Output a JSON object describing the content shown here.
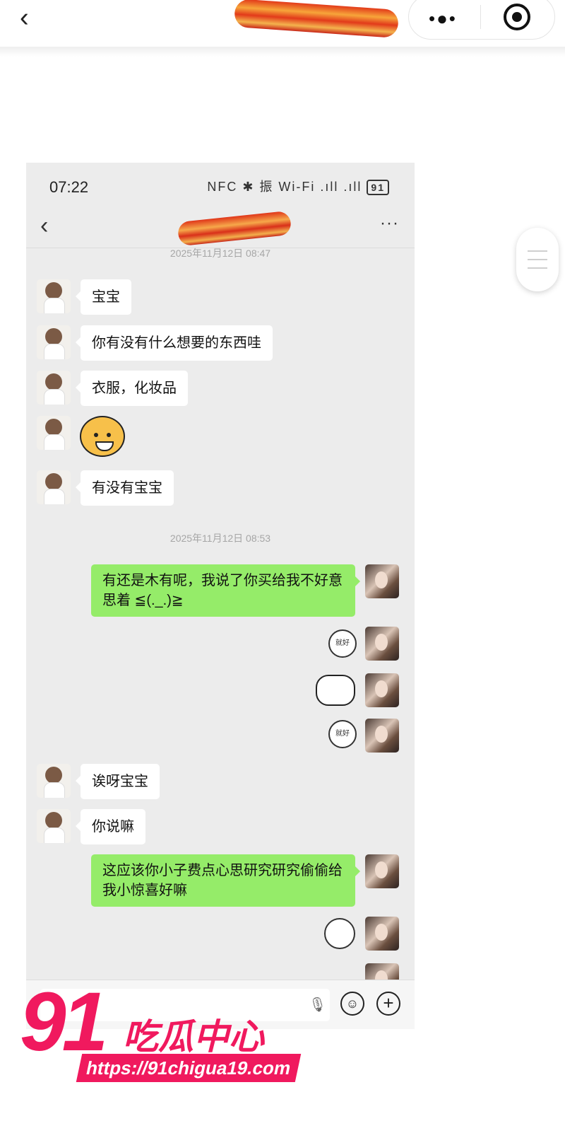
{
  "outer": {
    "back_icon": "chevron-left-icon",
    "more_icon": "more-dots-icon",
    "target_icon": "record-target-icon"
  },
  "phone": {
    "status": {
      "time": "07:22",
      "icons": "NFC ✱ 振 Wi-Fi .ıll .ıll",
      "battery": "91"
    },
    "chat": {
      "back_icon": "chevron-left-icon",
      "more": "···"
    },
    "messages": {
      "ts1": "2025年11月12日 08:47",
      "m1": "宝宝",
      "m2": "你有没有什么想要的东西哇",
      "m3": "衣服，化妆品",
      "m5": "有没有宝宝",
      "ts2": "2025年11月12日 08:53",
      "m6": "有还是木有呢，我说了你买给我不好意思着 ≦(._.)≧",
      "m7_sticker": "就好",
      "m9_sticker": "就好",
      "m10": "诶呀宝宝",
      "m11": "你说嘛",
      "m12": "这应该你小子费点心思研究研究偷偷给我小惊喜好嘛"
    },
    "input": {
      "mic_icon": "microphone-icon",
      "emoji_icon": "emoji-icon",
      "plus_icon": "plus-icon"
    }
  },
  "watermark": {
    "number": "91",
    "title": "吃瓜中心",
    "url": "https://91chigua19.com"
  },
  "colors": {
    "self_bubble": "#95ec69",
    "other_bubble": "#ffffff",
    "chat_bg": "#ececec",
    "watermark": "#f0195e"
  }
}
